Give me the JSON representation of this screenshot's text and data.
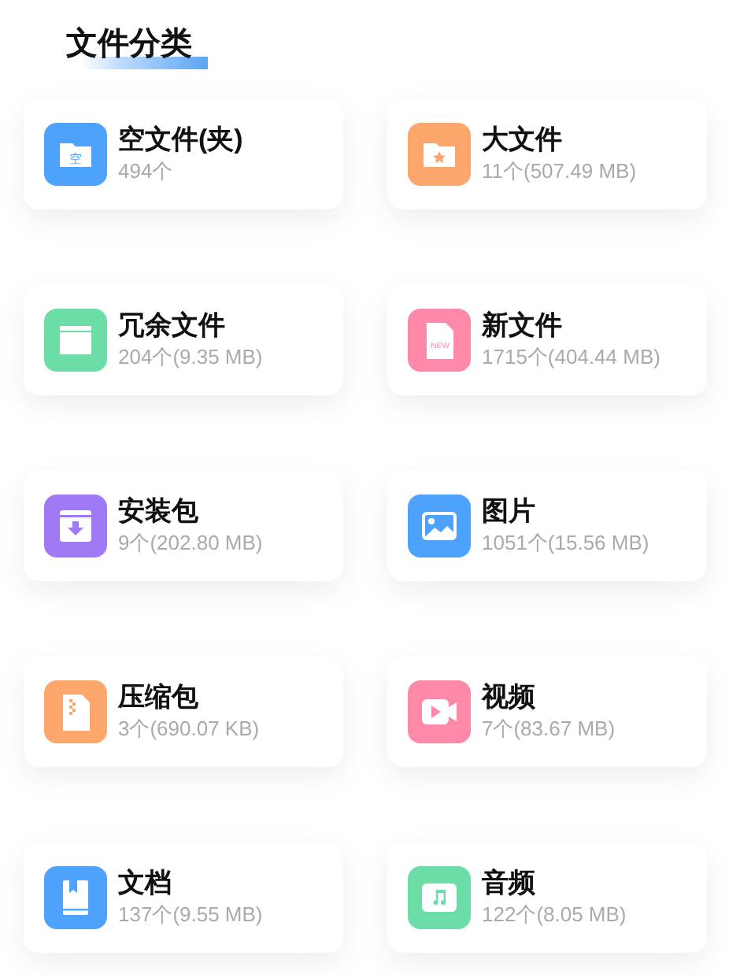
{
  "section_title": "文件分类",
  "categories": [
    {
      "name": "空文件(夹)",
      "detail": "494个",
      "kind": "empty-folder",
      "icon_label": "空",
      "color": "#4da3fb"
    },
    {
      "name": "大文件",
      "detail": "11个(507.49 MB)",
      "kind": "star-folder",
      "color": "#fca66c"
    },
    {
      "name": "冗余文件",
      "detail": "204个(9.35 MB)",
      "kind": "clapper",
      "color": "#6ddda8"
    },
    {
      "name": "新文件",
      "detail": "1715个(404.44 MB)",
      "kind": "new-doc",
      "icon_label": "NEW",
      "color": "#fd88a8"
    },
    {
      "name": "安装包",
      "detail": "9个(202.80 MB)",
      "kind": "package",
      "color": "#a07af5"
    },
    {
      "name": "图片",
      "detail": "1051个(15.56 MB)",
      "kind": "image",
      "color": "#4da3fb"
    },
    {
      "name": "压缩包",
      "detail": "3个(690.07 KB)",
      "kind": "zip",
      "color": "#fca66c"
    },
    {
      "name": "视频",
      "detail": "7个(83.67 MB)",
      "kind": "video",
      "color": "#fd88a8"
    },
    {
      "name": "文档",
      "detail": "137个(9.55 MB)",
      "kind": "book",
      "color": "#4da3fb"
    },
    {
      "name": "音频",
      "detail": "122个(8.05 MB)",
      "kind": "music",
      "color": "#6ddda8"
    }
  ]
}
